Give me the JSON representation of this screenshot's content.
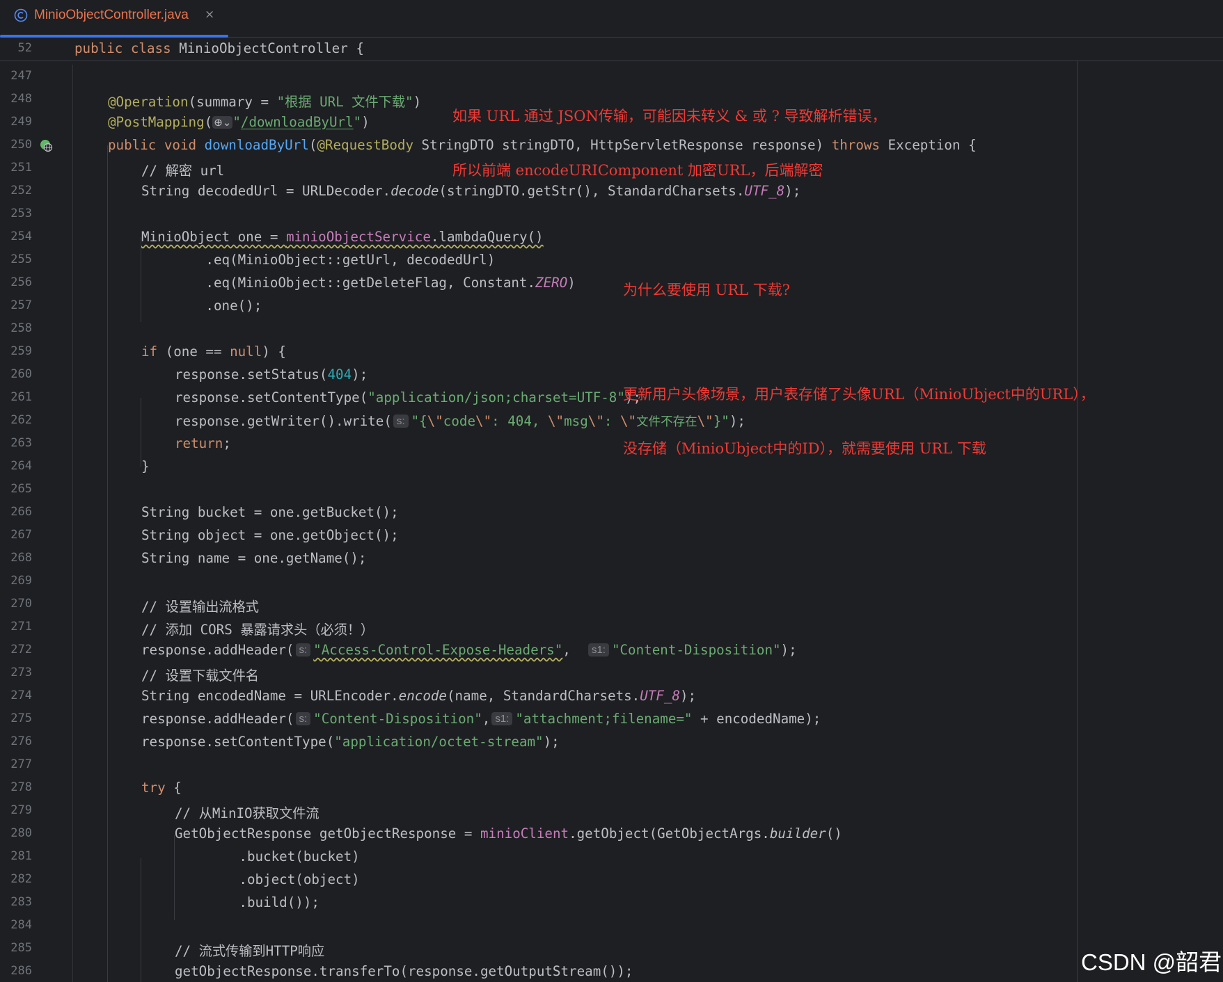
{
  "tab": {
    "icon": "class-c-icon",
    "title": "MinioObjectController.java",
    "close_symbol": "×"
  },
  "sticky": {
    "line_number": "52",
    "kw1": "public",
    "kw2": "class",
    "rest": " MinioObjectController {"
  },
  "lines": [
    "247",
    "248",
    "249",
    "250",
    "251",
    "252",
    "253",
    "254",
    "255",
    "256",
    "257",
    "258",
    "259",
    "260",
    "261",
    "262",
    "263",
    "264",
    "265",
    "266",
    "267",
    "268",
    "269",
    "270",
    "271",
    "272",
    "273",
    "274",
    "275",
    "276",
    "277",
    "278",
    "279",
    "280",
    "281",
    "282",
    "283",
    "284",
    "285",
    "286"
  ],
  "code": {
    "l248_ann": "@Operation",
    "l248_a": "(summary = ",
    "l248_str": "\"根据 URL 文件下载\"",
    "l248_b": ")",
    "l249_ann": "@PostMapping",
    "l249_a": "(",
    "l249_globe": "⊕⌄",
    "l249_q1": "\"",
    "l249_path": "/downloadByUrl",
    "l249_q2": "\"",
    "l249_b": ")",
    "l250_kw": "public void ",
    "l250_fn": "downloadByUrl",
    "l250_a": "(",
    "l250_ann": "@RequestBody",
    "l250_b": " StringDTO stringDTO, HttpServletResponse response) ",
    "l250_kw2": "throws",
    "l250_c": " Exception {",
    "l251_cmt": "// 解密 url",
    "l252_a": "String decodedUrl = URLDecoder.",
    "l252_it": "decode",
    "l252_b": "(stringDTO.getStr(), StandardCharsets.",
    "l252_fld": "UTF_8",
    "l252_c": ");",
    "l254_a": "MinioObject one = ",
    "l254_fld": "minioObjectService",
    "l254_b": ".lambdaQuery()",
    "l255": "        .eq(MinioObject::getUrl, decodedUrl)",
    "l256_a": "        .eq(MinioObject::getDeleteFlag, Constant.",
    "l256_fld": "ZERO",
    "l256_b": ")",
    "l257": "        .one();",
    "l259_kw": "if",
    "l259_a": " (one == ",
    "l259_kw2": "null",
    "l259_b": ") {",
    "l260_a": "response.setStatus(",
    "l260_num": "404",
    "l260_b": ");",
    "l261_a": "response.setContentType(",
    "l261_str": "\"application/json;charset=UTF-8\"",
    "l261_b": ");",
    "l262_a": "response.getWriter().write(",
    "l262_hint": "s:",
    "l262_str1": "\"{",
    "l262_esc1": "\\\"",
    "l262_str2": "code",
    "l262_esc2": "\\\"",
    "l262_str3": ": 404, ",
    "l262_esc3": "\\\"",
    "l262_str4": "msg",
    "l262_esc4": "\\\"",
    "l262_str5": ": ",
    "l262_esc5": "\\\"",
    "l262_str6": "文件不存在",
    "l262_esc6": "\\\"",
    "l262_str7": "}\"",
    "l262_b": ");",
    "l263_kw": "return",
    "l263_b": ";",
    "l264": "}",
    "l266": "String bucket = one.getBucket();",
    "l267": "String object = one.getObject();",
    "l268": "String name = one.getName();",
    "l270_cmt": "// 设置输出流格式",
    "l271_cmt": "// 添加 CORS 暴露请求头（必须！）",
    "l272_a": "response.addHeader(",
    "l272_hint1": "s:",
    "l272_str1": "\"Access-Control-Expose-Headers\"",
    "l272_mid": ",  ",
    "l272_hint2": "s1:",
    "l272_str2": "\"Content-Disposition\"",
    "l272_b": ");",
    "l273_cmt": "// 设置下载文件名",
    "l274_a": "String encodedName = URLEncoder.",
    "l274_it": "encode",
    "l274_b": "(name, StandardCharsets.",
    "l274_fld": "UTF_8",
    "l274_c": ");",
    "l275_a": "response.addHeader(",
    "l275_hint1": "s:",
    "l275_str1": "\"Content-Disposition\"",
    "l275_mid": ",",
    "l275_hint2": "s1:",
    "l275_str2": "\"attachment;filename=\"",
    "l275_b": " + encodedName);",
    "l276_a": "response.setContentType(",
    "l276_str": "\"application/octet-stream\"",
    "l276_b": ");",
    "l278_kw": "try",
    "l278_b": " {",
    "l279_cmt": "// 从MinIO获取文件流",
    "l280_a": "GetObjectResponse getObjectResponse = ",
    "l280_fld": "minioClient",
    "l280_b": ".getObject(GetObjectArgs.",
    "l280_it": "builder",
    "l280_c": "()",
    "l281": "        .bucket(bucket)",
    "l282": "        .object(object)",
    "l283": "        .build());",
    "l285_cmt": "// 流式传输到HTTP响应",
    "l286": "getObjectResponse.transferTo(response.getOutputStream());"
  },
  "notes": {
    "note1_line1": "如果 URL 通过 JSON传输，可能因未转义 & 或 ? 导致解析错误，",
    "note1_line2": "所以前端 encodeURIComponent 加密URL，后端解密",
    "note2_line1": "为什么要使用 URL 下载?",
    "note2_line2": "更新用户头像场景，用户表存储了头像URL（MinioUbject中的URL），",
    "note2_line3": "没存储（MinioUbject中的ID），就需要使用 URL 下载"
  },
  "gutter_icon": "endpoint-globe-icon",
  "watermark": "CSDN @韶君",
  "colors": {
    "background": "#1e1f22",
    "keyword": "#cf8e6d",
    "function": "#56a8f5",
    "annotation": "#b3ae60",
    "string": "#6aab73",
    "number": "#2aacb8",
    "field": "#c77dbb",
    "comment": "#7a7e85",
    "note": "#ee3a36",
    "tab_title": "#e8744f",
    "tab_accent": "#3574f0"
  }
}
